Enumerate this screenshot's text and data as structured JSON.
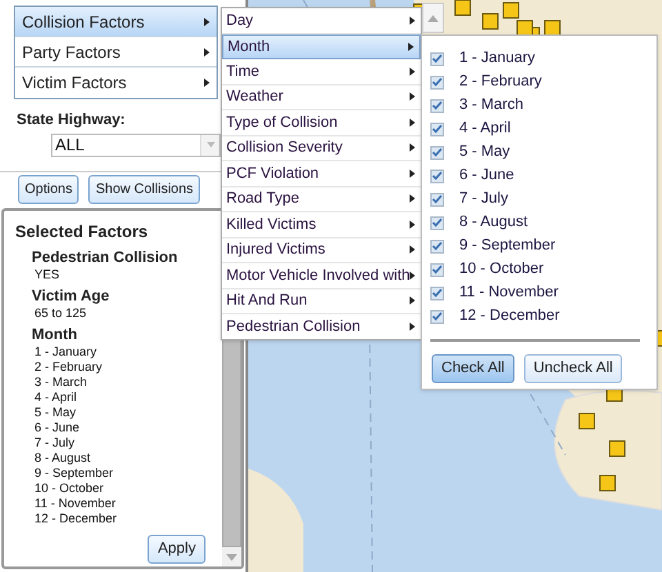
{
  "factor_menu": [
    {
      "label": "Collision Factors",
      "selected": true
    },
    {
      "label": "Party Factors",
      "selected": false
    },
    {
      "label": "Victim Factors",
      "selected": false
    }
  ],
  "state_highway": {
    "label": "State Highway:",
    "value": "ALL"
  },
  "buttons": [
    {
      "label": "Options"
    },
    {
      "label": "Show Collisions"
    }
  ],
  "selected_factors": {
    "title": "Selected Factors",
    "groups": [
      {
        "name": "Pedestrian Collision",
        "values": [
          "YES"
        ]
      },
      {
        "name": "Victim Age",
        "values": [
          "65 to 125"
        ]
      },
      {
        "name": "Month",
        "values": [
          "1 - January",
          "2 - February",
          "3 - March",
          "4 - April",
          "5 - May",
          "6 - June",
          "7 - July",
          "8 - August",
          "9 - September",
          "10 - October",
          "11 - November",
          "12 - December"
        ]
      }
    ],
    "apply": "Apply"
  },
  "submenu": [
    {
      "label": "Day",
      "selected": false
    },
    {
      "label": "Month",
      "selected": true
    },
    {
      "label": "Time",
      "selected": false
    },
    {
      "label": "Weather",
      "selected": false
    },
    {
      "label": "Type of Collision",
      "selected": false
    },
    {
      "label": "Collision Severity",
      "selected": false
    },
    {
      "label": "PCF Violation",
      "selected": false
    },
    {
      "label": "Road Type",
      "selected": false
    },
    {
      "label": "Killed Victims",
      "selected": false
    },
    {
      "label": "Injured Victims",
      "selected": false
    },
    {
      "label": "Motor Vehicle Involved with",
      "selected": false
    },
    {
      "label": "Hit And Run",
      "selected": false
    },
    {
      "label": "Pedestrian Collision",
      "selected": false
    }
  ],
  "month_options": [
    {
      "label": "1 - January",
      "checked": true
    },
    {
      "label": "2 - February",
      "checked": true
    },
    {
      "label": "3 - March",
      "checked": true
    },
    {
      "label": "4 - April",
      "checked": true
    },
    {
      "label": "5 - May",
      "checked": true
    },
    {
      "label": "6 - June",
      "checked": true
    },
    {
      "label": "7 - July",
      "checked": true
    },
    {
      "label": "8 - August",
      "checked": true
    },
    {
      "label": "9 - September",
      "checked": true
    },
    {
      "label": "10 - October",
      "checked": true
    },
    {
      "label": "11 - November",
      "checked": true
    },
    {
      "label": "12 - December",
      "checked": true
    }
  ],
  "check_buttons": [
    {
      "label": "Check All",
      "pressed": true
    },
    {
      "label": "Uncheck All",
      "pressed": false
    }
  ]
}
